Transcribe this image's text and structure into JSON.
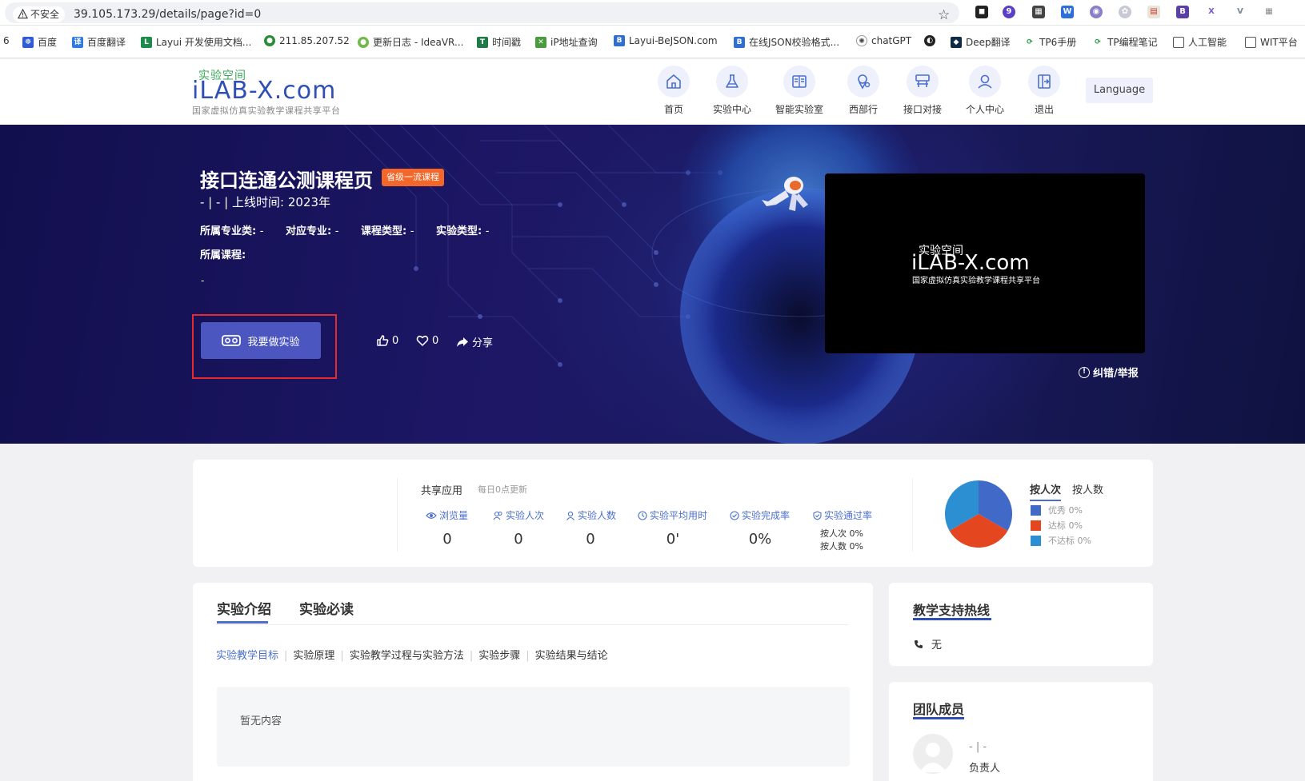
{
  "browser": {
    "insecure_label": "不安全",
    "url": "39.105.173.29/details/page?id=0",
    "ext_badge": "9",
    "bookmarks": [
      {
        "label": "6"
      },
      {
        "label": "百度"
      },
      {
        "label": "百度翻译"
      },
      {
        "label": "Layui 开发使用文档..."
      },
      {
        "label": "211.85.207.52"
      },
      {
        "label": "更新日志 - IdeaVR..."
      },
      {
        "label": "时间戳"
      },
      {
        "label": "iP地址查询"
      },
      {
        "label": "Layui-BeJSON.com"
      },
      {
        "label": "在线JSON校验格式..."
      },
      {
        "label": "chatGPT"
      },
      {
        "label": "Deep翻译"
      },
      {
        "label": "TP6手册"
      },
      {
        "label": "TP编程笔记"
      },
      {
        "label": "人工智能"
      },
      {
        "label": "WIT平台"
      }
    ]
  },
  "header": {
    "logo_top": "实验空间",
    "logo_main": "iLAB-X.com",
    "logo_sub": "国家虚拟仿真实验教学课程共享平台",
    "nav": [
      {
        "label": "首页",
        "icon": "home-icon"
      },
      {
        "label": "实验中心",
        "icon": "flask-icon"
      },
      {
        "label": "智能实验室",
        "icon": "lab-icon"
      },
      {
        "label": "西部行",
        "icon": "map-pin-icon"
      },
      {
        "label": "接口对接",
        "icon": "api-icon"
      },
      {
        "label": "个人中心",
        "icon": "user-icon"
      },
      {
        "label": "退出",
        "icon": "exit-icon"
      }
    ],
    "language_label": "Language"
  },
  "hero": {
    "title": "接口连通公测课程页",
    "badge": "省级一流课程",
    "line2_prefix": "- | - |",
    "online_time_label": "上线时间:",
    "online_time_value": "2023年",
    "meta": {
      "major_cat_label": "所属专业类:",
      "major_cat_value": "-",
      "major_label": "对应专业:",
      "major_value": "-",
      "course_type_label": "课程类型:",
      "course_type_value": "-",
      "exp_type_label": "实验类型:",
      "exp_type_value": "-",
      "course_label": "所属课程:"
    },
    "dash": "-",
    "do_exp_label": "我要做实验",
    "likes": "0",
    "favorites": "0",
    "share_label": "分享",
    "video_logo_top": "实验空间",
    "video_logo_main": "iLAB-X.com",
    "video_logo_sub": "国家虚拟仿真实验教学课程共享平台",
    "report_label": "纠错/举报"
  },
  "stats": {
    "shared_label": "共享应用",
    "update_label": "每日0点更新",
    "columns": [
      {
        "label": "浏览量",
        "value": "0"
      },
      {
        "label": "实验人次",
        "value": "0"
      },
      {
        "label": "实验人数",
        "value": "0"
      },
      {
        "label": "实验平均用时",
        "value": "0'"
      },
      {
        "label": "实验完成率",
        "value": "0%"
      },
      {
        "label": "实验通过率",
        "value": ""
      }
    ],
    "pass_by_times": "按人次 0%",
    "pass_by_people": "按人数 0%",
    "pie_tabs": [
      "按人次",
      "按人数"
    ],
    "legend": [
      {
        "label": "优秀 0%",
        "color": "#4169c8"
      },
      {
        "label": "达标 0%",
        "color": "#e4461f"
      },
      {
        "label": "不达标 0%",
        "color": "#2c8fd1"
      }
    ]
  },
  "intro": {
    "tabs": [
      "实验介绍",
      "实验必读"
    ],
    "sub_tabs": [
      "实验教学目标",
      "实验原理",
      "实验教学过程与实验方法",
      "实验步骤",
      "实验结果与结论"
    ],
    "empty_text": "暂无内容"
  },
  "hotline": {
    "title": "教学支持热线",
    "phone": "无"
  },
  "team": {
    "title": "团队成员",
    "member_name": "- | -",
    "member_role": "负责人"
  }
}
